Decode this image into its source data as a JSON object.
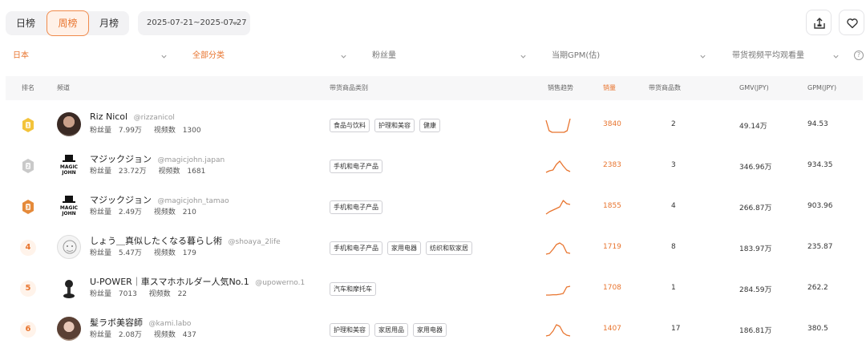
{
  "tabs": {
    "day": "日榜",
    "week": "周榜",
    "month": "月榜"
  },
  "date_range": "2025-07-21~2025-07-27",
  "filters": {
    "region": "日本",
    "category": "全部分类",
    "followers": "粉丝量",
    "gpm": "当期GPM(估)",
    "avg_views": "带货视频平均观看量",
    "info": "?"
  },
  "columns": {
    "rank": "排名",
    "channel": "频道",
    "category": "带货商品类别",
    "trend": "销售趋势",
    "sales": "销量",
    "count": "带货商品数",
    "gmv": "GMV(JPY)",
    "gpm": "GPM(JPY)"
  },
  "labels": {
    "followers": "粉丝量",
    "videos": "视频数"
  },
  "icons": {
    "export": "export-icon",
    "favorite": "heart-icon",
    "chevron": "chevron-down-icon",
    "medal": "medal-icon"
  },
  "colors": {
    "accent": "#e8742e",
    "gold": "#f3c33a",
    "silver": "#c9c9c9",
    "bronze": "#e58a3a"
  },
  "rows": [
    {
      "rank": "1",
      "name": "Riz Nicol",
      "handle": "@rizzanicol",
      "followers": "7.99万",
      "videos": "1300",
      "tags": [
        "食品与饮料",
        "护理和美容",
        "健康"
      ],
      "trend": [
        0.2,
        0.85,
        0.95,
        0.95,
        0.95,
        0.95,
        0.95,
        0.85,
        0.1
      ],
      "sales": "3840",
      "count": "2",
      "gmv": "49.14万",
      "gpm": "94.53"
    },
    {
      "rank": "2",
      "name": "マジックジョン",
      "handle": "@magicjohn.japan",
      "followers": "23.72万",
      "videos": "1681",
      "tags": [
        "手机和电子产品"
      ],
      "trend": [
        0.9,
        0.8,
        0.75,
        0.4,
        0.2,
        0.5,
        0.75,
        0.85
      ],
      "sales": "2383",
      "count": "3",
      "gmv": "346.96万",
      "gpm": "934.35"
    },
    {
      "rank": "3",
      "name": "マジックジョン",
      "handle": "@magicjohn_tamao",
      "followers": "2.49万",
      "videos": "210",
      "tags": [
        "手机和电子产品"
      ],
      "trend": [
        0.95,
        0.8,
        0.7,
        0.6,
        0.5,
        0.1,
        0.3,
        0.35
      ],
      "sales": "1855",
      "count": "4",
      "gmv": "266.87万",
      "gpm": "903.96"
    },
    {
      "rank": "4",
      "name": "しょう＿真似したくなる暮らし術",
      "handle": "@shoaya_2life",
      "followers": "5.47万",
      "videos": "179",
      "tags": [
        "手机和电子产品",
        "家用电器",
        "纺织和软家居"
      ],
      "trend": [
        0.9,
        0.85,
        0.6,
        0.3,
        0.2,
        0.35,
        0.8,
        0.85
      ],
      "sales": "1719",
      "count": "8",
      "gmv": "183.97万",
      "gpm": "235.87"
    },
    {
      "rank": "5",
      "name": "U-POWER｜車スマホホルダー人気No.1",
      "handle": "@upowerno.1",
      "followers": "7013",
      "videos": "22",
      "tags": [
        "汽车和摩托车"
      ],
      "trend": [
        0.9,
        0.9,
        0.88,
        0.88,
        0.85,
        0.8,
        0.4,
        0.35
      ],
      "sales": "1708",
      "count": "1",
      "gmv": "284.59万",
      "gpm": "262.2"
    },
    {
      "rank": "6",
      "name": "髪ラボ美容師",
      "handle": "@kami.labo",
      "followers": "2.08万",
      "videos": "437",
      "tags": [
        "护理和美容",
        "家居用品",
        "家用电器"
      ],
      "trend": [
        0.9,
        0.85,
        0.6,
        0.2,
        0.3,
        0.7,
        0.85,
        0.9
      ],
      "sales": "1407",
      "count": "17",
      "gmv": "186.81万",
      "gpm": "380.5"
    }
  ]
}
